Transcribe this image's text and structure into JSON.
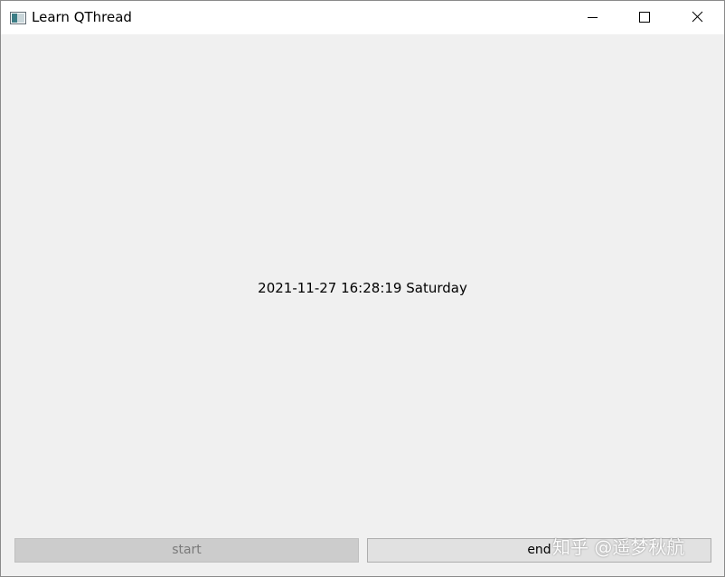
{
  "window": {
    "title": "Learn QThread",
    "controls": {
      "minimize_icon": "minimize-icon",
      "maximize_icon": "maximize-icon",
      "close_icon": "close-icon"
    }
  },
  "main": {
    "datetime_text": "2021-11-27 16:28:19 Saturday"
  },
  "buttons": {
    "start_label": "start",
    "start_enabled": false,
    "end_label": "end",
    "end_enabled": true
  },
  "watermark": {
    "text": "知乎 @遥梦秋航"
  },
  "colors": {
    "window_bg": "#f0f0f0",
    "titlebar_bg": "#ffffff",
    "button_disabled_bg": "#cccccc",
    "button_bg": "#e1e1e1"
  }
}
